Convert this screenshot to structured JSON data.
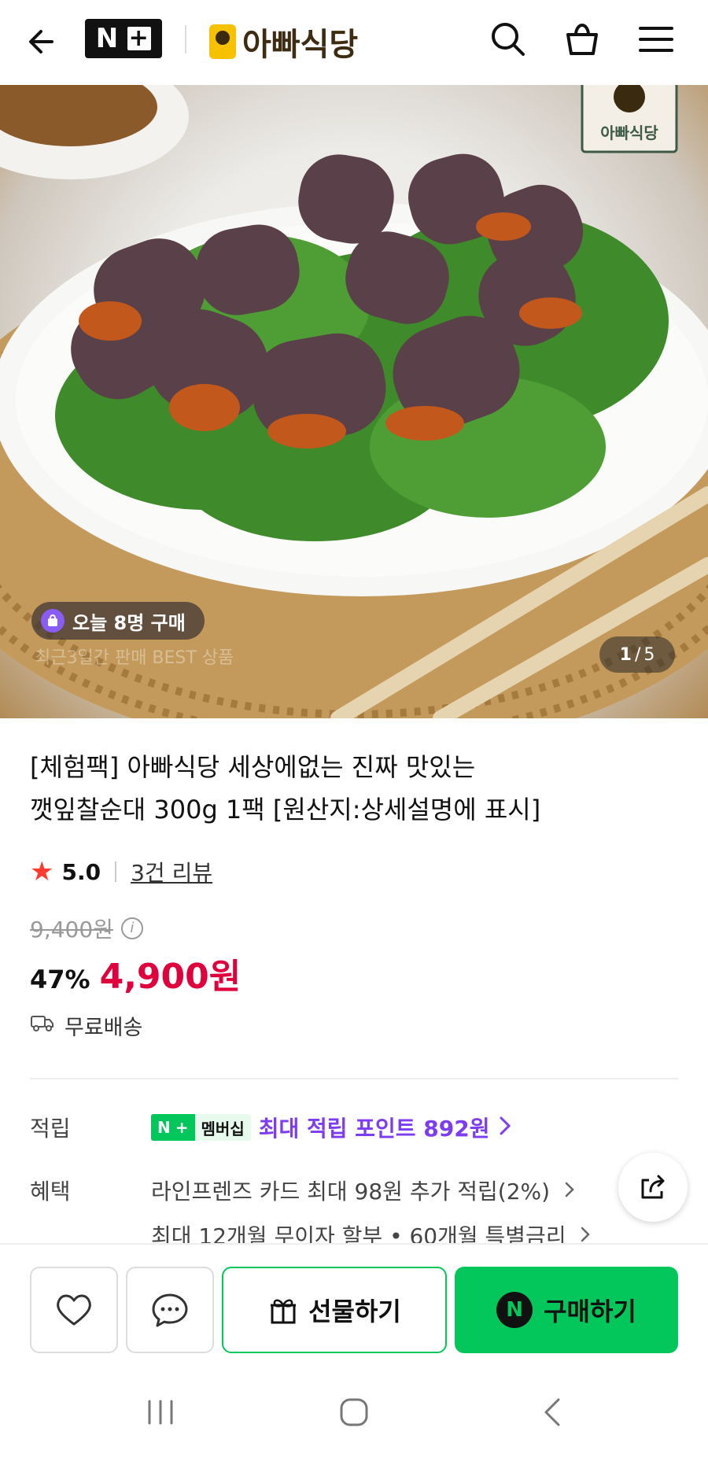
{
  "header": {
    "nplus_label": "N",
    "brand_name": "아빠식당"
  },
  "hero": {
    "watermark_brand": "아빠식당",
    "buyers_badge": "오늘 8명 구매",
    "ghost_text": "최근3일간 판매 BEST 상품",
    "pager_current": "1",
    "pager_sep": "/",
    "pager_total": "5"
  },
  "product": {
    "title_line1": "[체험팩] 아빠식당 세상에없는 진짜 맛있는",
    "title_line2": "깻잎찰순대 300g 1팩 [원산지:상세설명에 표시]",
    "rating": "5.0",
    "reviews": "3건 리뷰",
    "original_price": "9,400원",
    "discount": "47%",
    "price": "4,900원",
    "shipping": "무료배송"
  },
  "details": {
    "points_label": "적립",
    "membership_badge": "멤버십",
    "points_text": "최대 적립 포인트 892원",
    "benefits_label": "혜택",
    "benefit1": "라인프렌즈 카드 최대 98원 추가 적립(2%)",
    "benefit2": "최대 12개월 무이자 할부 • 60개월 특별금리"
  },
  "actions": {
    "gift": "선물하기",
    "buy": "구매하기",
    "buy_n": "N"
  },
  "colors": {
    "accent_green": "#03c75a",
    "price_red": "#e0003c",
    "points_purple": "#7d3cf2",
    "star": "#ff3b2f"
  }
}
